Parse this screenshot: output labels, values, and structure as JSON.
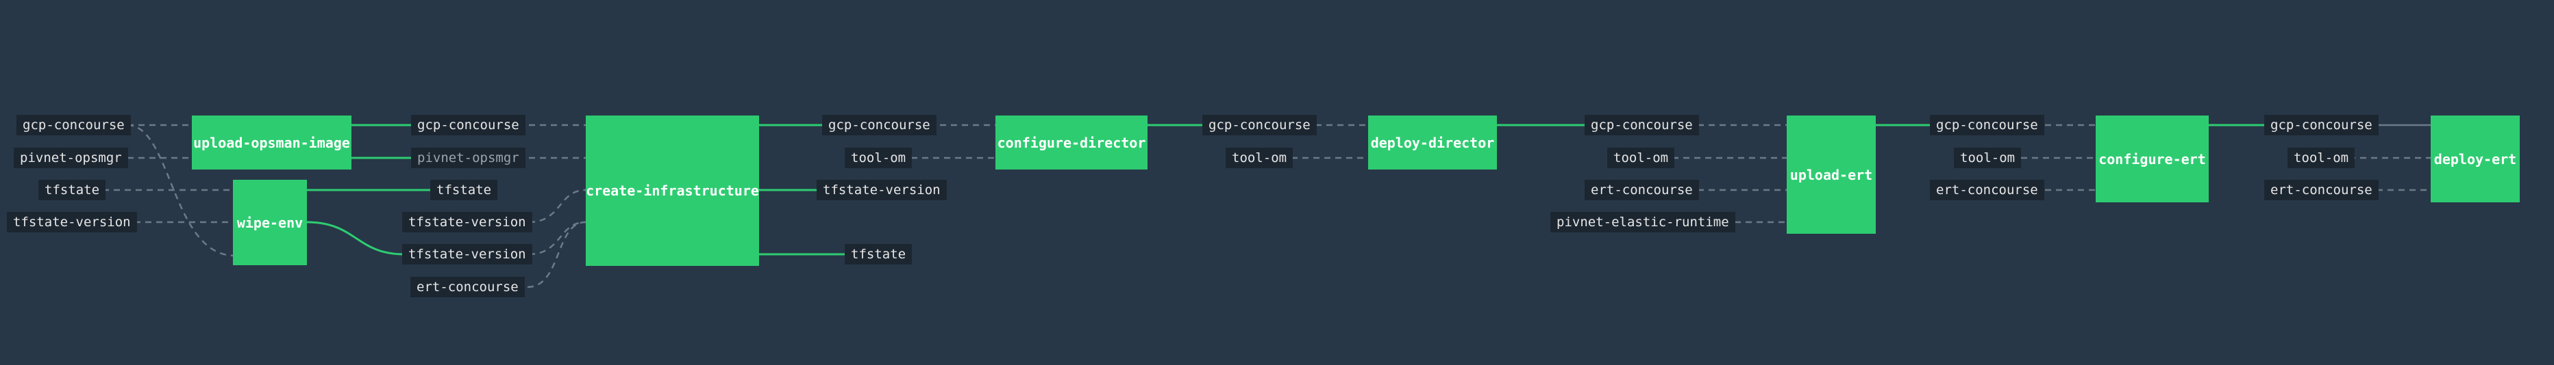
{
  "jobs": {
    "upload_opsman_image": "upload-opsman-image",
    "wipe_env": "wipe-env",
    "create_infrastructure": "create-infrastructure",
    "configure_director": "configure-director",
    "deploy_director": "deploy-director",
    "upload_ert": "upload-ert",
    "configure_ert": "configure-ert",
    "deploy_ert": "deploy-ert"
  },
  "resources": {
    "gcp_concourse": "gcp-concourse",
    "pivnet_opsmgr": "pivnet-opsmgr",
    "tfstate": "tfstate",
    "tfstate_version": "tfstate-version",
    "ert_concourse": "ert-concourse",
    "tool_om": "tool-om",
    "pivnet_elastic_runtime": "pivnet-elastic-runtime"
  },
  "colors": {
    "background": "#273747",
    "job": "#2ecc71",
    "resource_bg": "#1c2631",
    "resource_text": "#e6e6e6",
    "passive_text": "#9aa4ae",
    "edge_dashed": "#6c7a88"
  }
}
